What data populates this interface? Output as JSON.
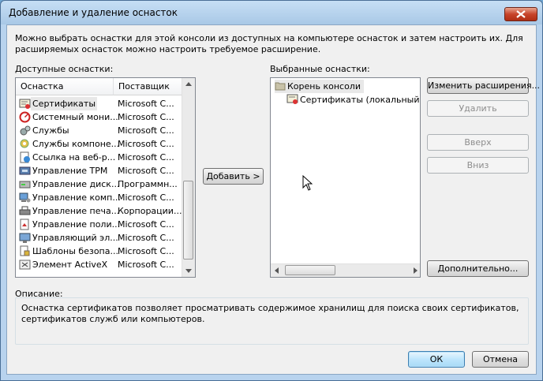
{
  "window": {
    "title": "Добавление и удаление оснасток"
  },
  "intro_text": "Можно выбрать оснастки для этой консоли из доступных на компьютере оснасток и затем настроить их. Для расширяемых оснасток можно настроить требуемое расширение.",
  "available": {
    "label": "Доступные оснастки:",
    "col_snapin": "Оснастка",
    "col_vendor": "Поставщик",
    "items": [
      {
        "name": "Сертификаты",
        "vendor": "Microsoft C..."
      },
      {
        "name": "Системный мони...",
        "vendor": "Microsoft C..."
      },
      {
        "name": "Службы",
        "vendor": "Microsoft C..."
      },
      {
        "name": "Службы компоне...",
        "vendor": "Microsoft C..."
      },
      {
        "name": "Ссылка на веб-р...",
        "vendor": "Microsoft C..."
      },
      {
        "name": "Управление TPM",
        "vendor": "Microsoft C..."
      },
      {
        "name": "Управление диск...",
        "vendor": "Программн..."
      },
      {
        "name": "Управление комп...",
        "vendor": "Microsoft C..."
      },
      {
        "name": "Управление печа...",
        "vendor": "Корпорации..."
      },
      {
        "name": "Управление поли...",
        "vendor": "Microsoft C..."
      },
      {
        "name": "Управляющий эл...",
        "vendor": "Microsoft C..."
      },
      {
        "name": "Шаблоны безопа...",
        "vendor": "Microsoft C..."
      },
      {
        "name": "Элемент ActiveX",
        "vendor": "Microsoft C..."
      }
    ]
  },
  "add_button": "Добавить >",
  "selected": {
    "label": "Выбранные оснастки:",
    "root": "Корень консоли",
    "child": "Сертификаты (локальный ко"
  },
  "buttons": {
    "extensions": "Изменить расширения...",
    "remove": "Удалить",
    "up": "Вверх",
    "down": "Вниз",
    "advanced": "Дополнительно...",
    "ok": "ОК",
    "cancel": "Отмена"
  },
  "description": {
    "label": "Описание:",
    "text": "Оснастка сертификатов позволяет просматривать содержимое хранилищ для поиска своих сертификатов, сертификатов служб или компьютеров."
  }
}
